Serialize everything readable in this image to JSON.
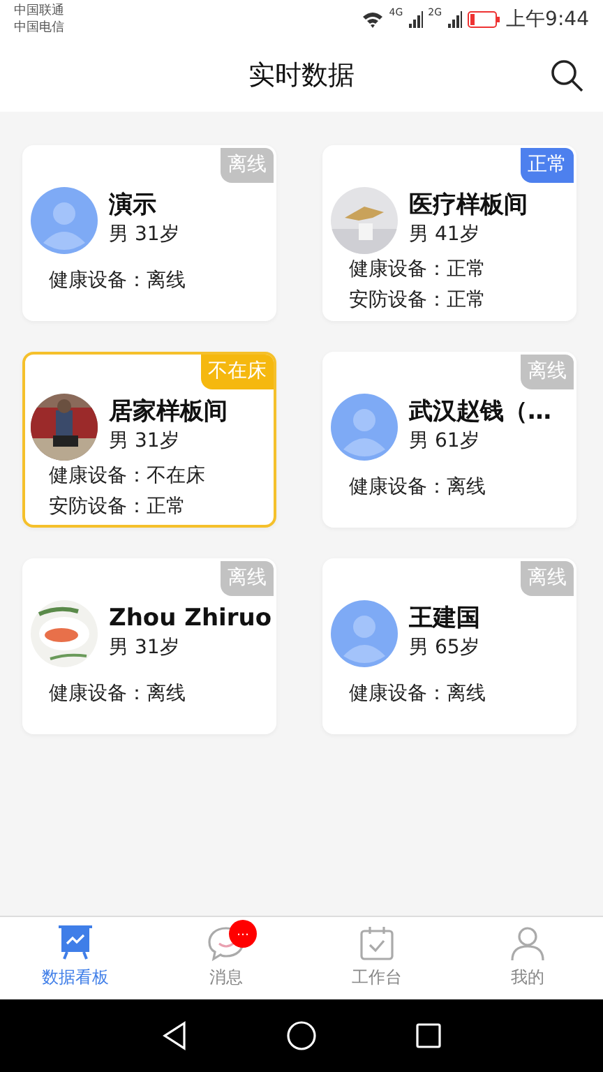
{
  "status_bar": {
    "carriers": [
      "中国联通",
      "中国电信"
    ],
    "networks": [
      "4G",
      "2G"
    ],
    "time": "上午9:44"
  },
  "header": {
    "title": "实时数据"
  },
  "cards": [
    {
      "name": "演示",
      "info": "男 31岁",
      "kind": "offline",
      "badge": "离线",
      "avatar": {
        "kind": "default"
      },
      "lines": [
        "健康设备：离线"
      ]
    },
    {
      "name": "医疗样板间",
      "info": "男 41岁",
      "kind": "normal",
      "badge": "正常",
      "avatar": {
        "kind": "picture"
      },
      "lines": [
        "健康设备：正常",
        "安防设备：正常"
      ]
    },
    {
      "name": "居家样板间",
      "info": "男 31岁",
      "kind": "away",
      "badge": "不在床",
      "avatar": {
        "kind": "picture"
      },
      "lines": [
        "健康设备：不在床",
        "安防设备：正常"
      ]
    },
    {
      "name": "武汉赵钱（…",
      "info": "男 61岁",
      "kind": "offline",
      "badge": "离线",
      "avatar": {
        "kind": "default"
      },
      "lines": [
        "健康设备：离线"
      ]
    },
    {
      "name": "Zhou Zhiruo",
      "info": "男 31岁",
      "kind": "offline",
      "badge": "离线",
      "avatar": {
        "kind": "picture"
      },
      "lines": [
        "健康设备：离线"
      ]
    },
    {
      "name": "王建国",
      "info": "男 65岁",
      "kind": "offline",
      "badge": "离线",
      "avatar": {
        "kind": "default"
      },
      "lines": [
        "健康设备：离线"
      ]
    }
  ],
  "tabs": [
    {
      "label": "数据看板",
      "kind": "board",
      "selected": true
    },
    {
      "label": "消息",
      "kind": "chat",
      "selected": false,
      "badge": "…"
    },
    {
      "label": "工作台",
      "kind": "calendar",
      "selected": false
    },
    {
      "label": "我的",
      "kind": "person",
      "selected": false
    }
  ]
}
